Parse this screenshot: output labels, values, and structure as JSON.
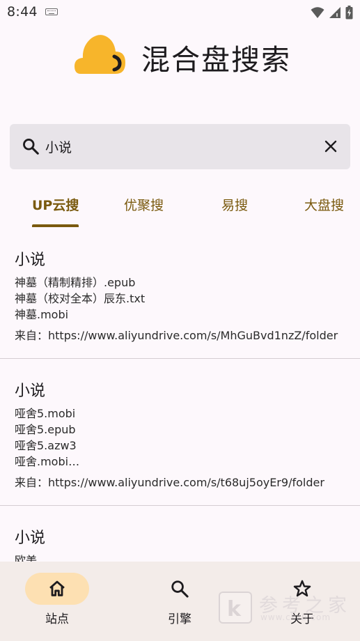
{
  "status_bar": {
    "time": "8:44"
  },
  "app": {
    "title": "混合盘搜索",
    "logo_color": "#f7b52b"
  },
  "search": {
    "value": "小说",
    "placeholder": ""
  },
  "tabs": [
    {
      "label": "UP云搜",
      "active": true
    },
    {
      "label": "优聚搜",
      "active": false
    },
    {
      "label": "易搜",
      "active": false
    },
    {
      "label": "大盘搜",
      "active": false
    }
  ],
  "results": [
    {
      "title": "小说",
      "files": [
        "神墓（精制精排）.epub",
        "神墓（校对全本）辰东.txt",
        "神墓.mobi"
      ],
      "source": "来自：https://www.aliyundrive.com/s/MhGuBvd1nzZ/folder"
    },
    {
      "title": "小说",
      "files": [
        "哑舍5.mobi",
        "哑舍5.epub",
        "哑舍5.azw3",
        "哑舍.mobi…"
      ],
      "source": "来自：https://www.aliyundrive.com/s/t68uj5oyEr9/folder"
    },
    {
      "title": "小说",
      "files": [
        "欧美"
      ]
    }
  ],
  "bottom_nav": [
    {
      "label": "站点",
      "icon": "home-icon",
      "active": true
    },
    {
      "label": "引擎",
      "icon": "search-icon",
      "active": false
    },
    {
      "label": "关于",
      "icon": "star-icon",
      "active": false
    }
  ],
  "watermark": {
    "letter": "k",
    "text": "参考之家",
    "url": "www.ckzb.com"
  },
  "colors": {
    "accent": "#7a5a0e",
    "nav_active_pill": "#fde0b2",
    "search_bg": "#e8e4e9",
    "background": "#fdf8fc"
  }
}
